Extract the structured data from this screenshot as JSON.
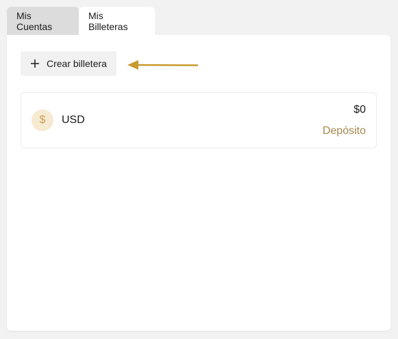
{
  "tabs": [
    {
      "label": "Mis Cuentas",
      "active": false
    },
    {
      "label": "Mis Billeteras",
      "active": true
    }
  ],
  "toolbar": {
    "create_wallet_label": "Crear billetera",
    "create_wallet_icon": "plus-icon",
    "annotation_icon": "arrow-left-icon"
  },
  "wallets": [
    {
      "icon": "dollar-icon",
      "icon_symbol": "$",
      "currency": "USD",
      "balance": "$0",
      "action_label": "Depósito"
    }
  ],
  "colors": {
    "page_background": "#f2f2f2",
    "inactive_tab": "#dcdcdc",
    "panel": "#ffffff",
    "accent_gold": "#a4884c",
    "arrow_gold": "#c79a2e",
    "coin_background": "#f6ead2"
  }
}
